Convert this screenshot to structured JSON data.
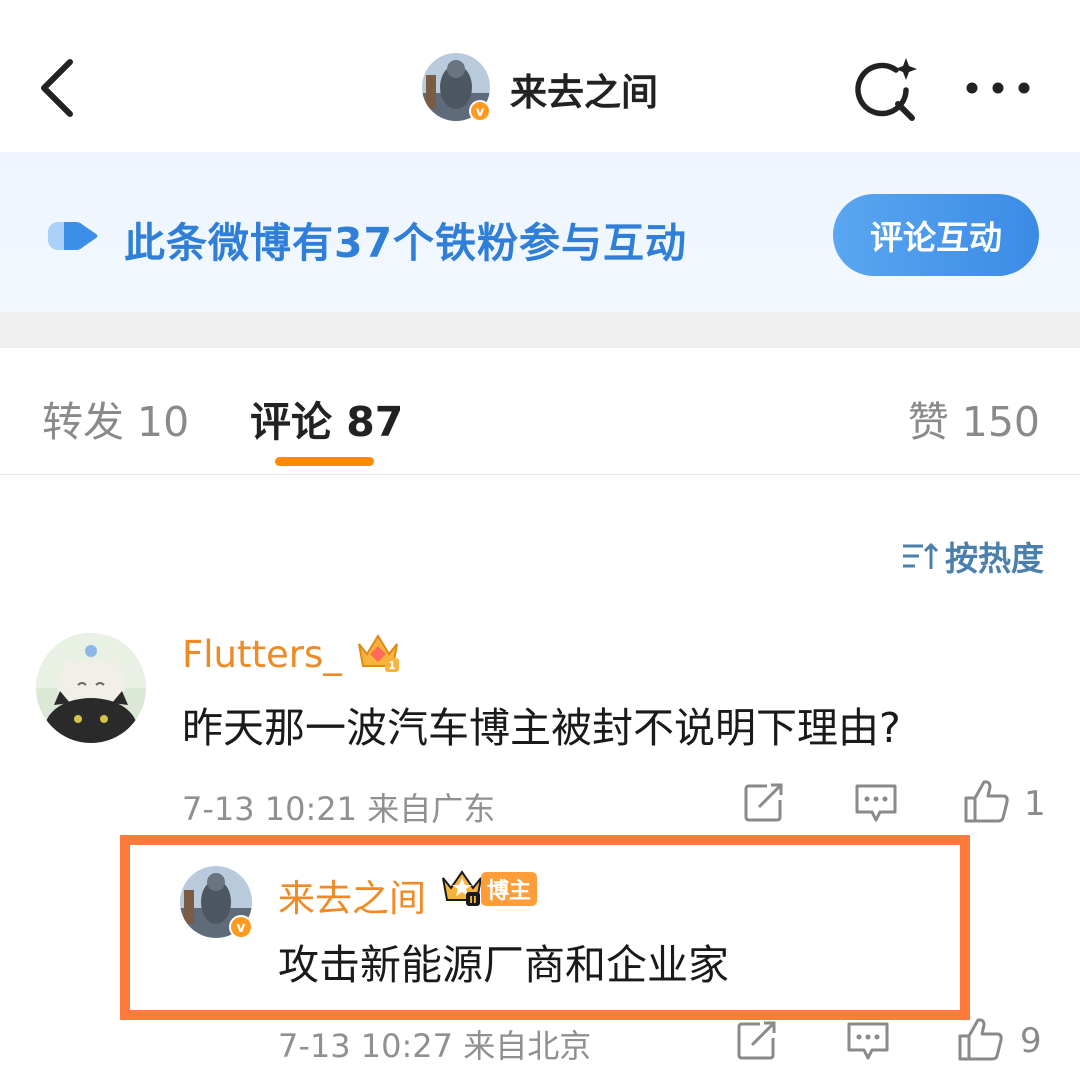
{
  "header": {
    "title": "来去之间",
    "back_icon": "chevron-left-icon",
    "search_icon": "search-sparkle-icon",
    "more_icon": "more-dots-icon"
  },
  "banner": {
    "text": "此条微博有37个铁粉参与互动",
    "button_label": "评论互动"
  },
  "tabs": [
    {
      "label": "转发 10",
      "active": false
    },
    {
      "label": "评论 87",
      "active": true
    },
    {
      "label": "赞 150",
      "active": false
    }
  ],
  "sort": {
    "label": "按热度",
    "icon": "sort-icon"
  },
  "comments": [
    {
      "username": "Flutters_",
      "text": "昨天那一波汽车博主被封不说明下理由?",
      "meta": "7-13 10:21  来自广东",
      "likes": "1"
    },
    {
      "username": "来去之间",
      "badge": "博主",
      "text": "攻击新能源厂商和企业家",
      "meta": "7-13 10:27  来自北京",
      "likes": "9"
    }
  ],
  "colors": {
    "accent_orange": "#ff8a00",
    "username_orange": "#f08a27",
    "banner_blue": "#2f7ed8",
    "highlight_border": "#ff7a3d"
  }
}
